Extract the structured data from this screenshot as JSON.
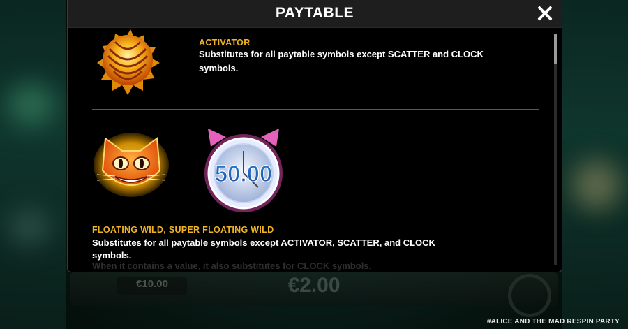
{
  "paytable": {
    "title": "PAYTABLE",
    "close_label": "close",
    "sections": [
      {
        "heading": "ACTIVATOR",
        "lines": [
          "Substitutes for all paytable symbols except SCATTER and CLOCK",
          "symbols."
        ]
      },
      {
        "heading": "FLOATING WILD, SUPER FLOATING WILD",
        "lines": [
          "Substitutes for all paytable symbols except ACTIVATOR, SCATTER, and CLOCK",
          "symbols."
        ],
        "faded_line": "When it contains a value, it also substitutes for CLOCK symbols."
      }
    ],
    "clock_value": "50.00",
    "scroll_position": 0.0
  },
  "game_bar": {
    "bet_value": "€10.00",
    "win_value": "€2.00"
  },
  "footer": {
    "game_name": "#ALICE AND THE MAD RESPIN PARTY"
  },
  "colors": {
    "heading": "#f0b323",
    "text": "#ffffff",
    "modal_bg": "#000000",
    "header_bg": "#1e1e1e"
  }
}
